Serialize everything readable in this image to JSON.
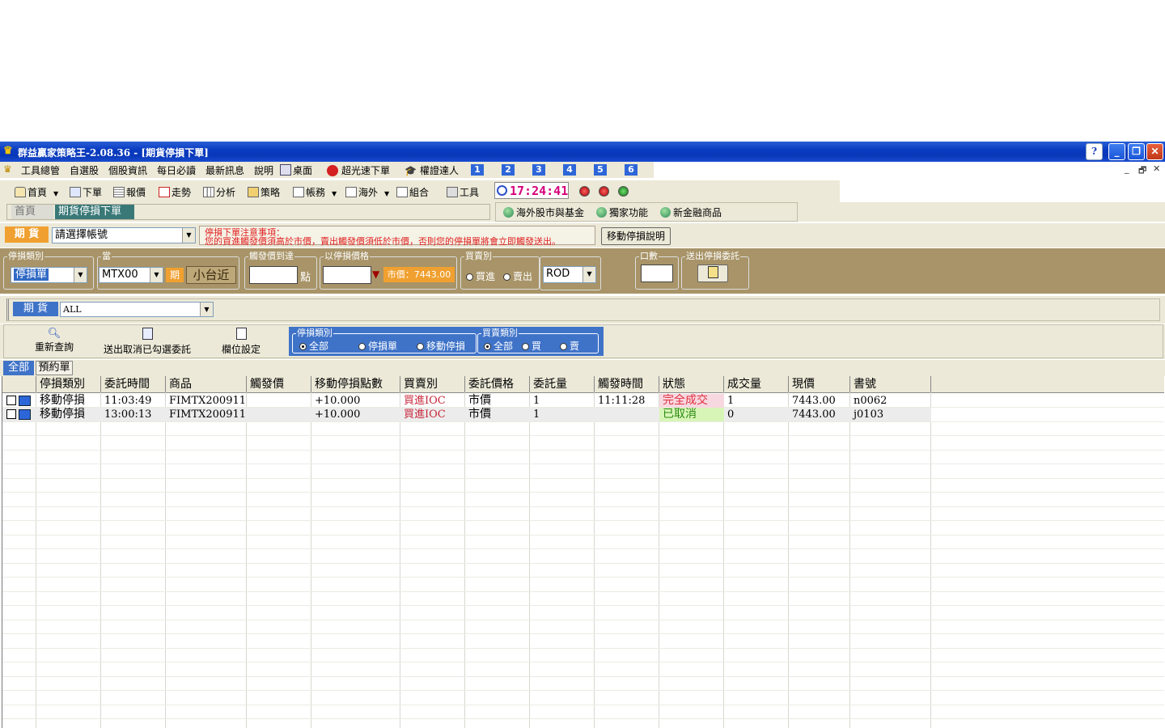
{
  "window": {
    "title": "群益贏家策略王-2.08.36 - [期貨停損下單]",
    "help_label": "?",
    "minimize_label": "_",
    "restore_label": "❐",
    "close_label": "✕"
  },
  "menu": {
    "items": [
      "工具總管",
      "自選股",
      "個股資訊",
      "每日必讀",
      "最新訊息",
      "說明",
      "桌面",
      "超光速下單",
      "權證達人"
    ],
    "numbers": [
      "1",
      "2",
      "3",
      "4",
      "5",
      "6"
    ],
    "mdi": {
      "minimize": "_",
      "restore": "🗗",
      "close": "✕"
    }
  },
  "toolbar": {
    "items": [
      "首頁",
      "下單",
      "報價",
      "走勢",
      "分析",
      "策略",
      "帳務",
      "海外",
      "組合",
      "工具"
    ],
    "clock": "17:24:41"
  },
  "tabs": {
    "home": "首頁",
    "active": "期貨停損下單"
  },
  "links": [
    "海外股市與基金",
    "獨家功能",
    "新金融商品"
  ],
  "account": {
    "label": "期 貨",
    "select_value": "請選擇帳號",
    "notice_title": "停損下單注意事項：",
    "notice_body": "您的買進觸發價須高於市價，賣出觸發價須低於市價，否則您的停損單將會立即觸發送出。",
    "explain_button": "移動停損說明"
  },
  "order_form": {
    "stoploss_type_legend": "停損類別",
    "stoploss_type_value": "停損單",
    "product_legend": "當",
    "product_value": "MTX00",
    "period_tag": "期",
    "product_name": "小台近",
    "trigger_legend": "觸發價到達",
    "trigger_unit": "點",
    "price_legend": "以停損價格",
    "market_price": "市價：7443.00",
    "side_legend": "買賣別",
    "buy_label": "買進",
    "sell_label": "賣出",
    "tif_value": "ROD",
    "qty_legend": "口數",
    "send_legend": "送出停損委託"
  },
  "filter": {
    "label": "期 貨",
    "select_value": "ALL"
  },
  "actions": {
    "requery": "重新查詢",
    "cancel_selected": "送出取消已勾選委託",
    "column_settings": "欄位設定",
    "type_legend": "停損類別",
    "type_options": [
      "全部",
      "停損單",
      "移動停損"
    ],
    "side_legend": "買賣類別",
    "side_options": [
      "全部",
      "買",
      "賣"
    ]
  },
  "subtabs": [
    "全部",
    "預約單"
  ],
  "table": {
    "headers": [
      "停損類別",
      "委託時間",
      "商品",
      "觸發價",
      "移動停損點數",
      "買賣別",
      "委託價格",
      "委託量",
      "觸發時間",
      "狀態",
      "成交量",
      "現價",
      "書號"
    ],
    "rows": [
      [
        "移動停損",
        "11:03:49",
        "FIMTX200911",
        "",
        "+10.000",
        "買進IOC",
        "市價",
        "1",
        "11:11:28",
        "完全成交",
        "1",
        "7443.00",
        "n0062"
      ],
      [
        "移動停損",
        "13:00:13",
        "FIMTX200911",
        "",
        "+10.000",
        "買進IOC",
        "市價",
        "1",
        "",
        "已取消",
        "0",
        "7443.00",
        "j0103"
      ]
    ]
  },
  "colors": {
    "titlebar": "#0a3cc1",
    "form_background": "#a89468",
    "clock_text": "#d6007a",
    "side_text": "#c8283c",
    "status_filled_bg": "#f8d8e0",
    "status_cancelled_bg": "#d8f5b8"
  }
}
